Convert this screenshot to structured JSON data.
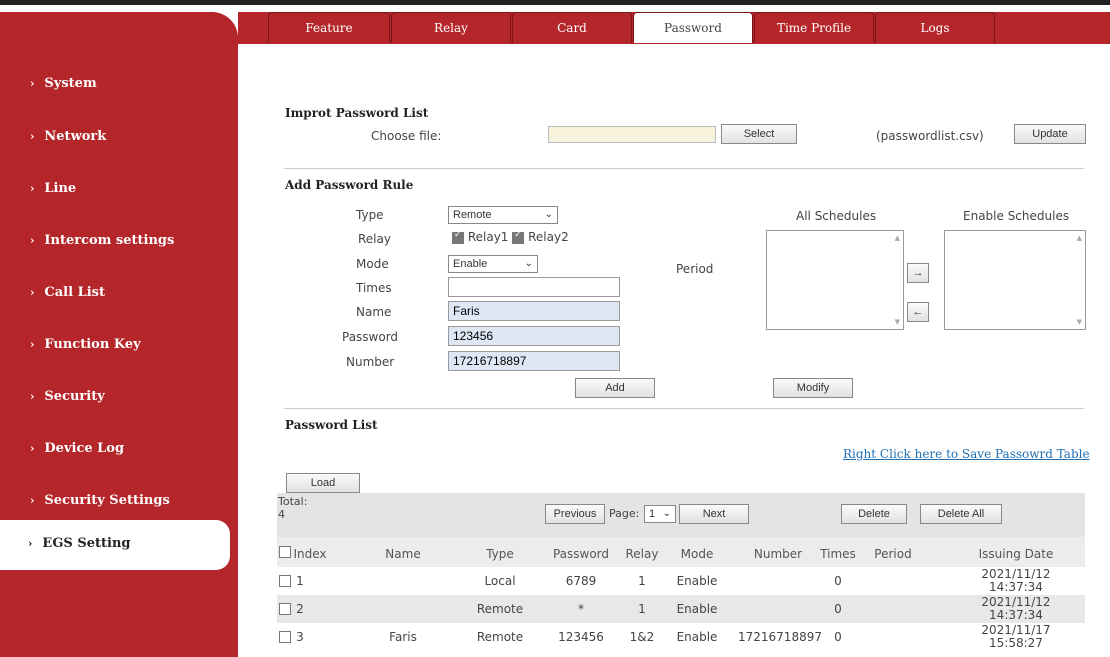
{
  "sidebar": {
    "items": [
      {
        "label": "System"
      },
      {
        "label": "Network"
      },
      {
        "label": "Line"
      },
      {
        "label": "Intercom settings"
      },
      {
        "label": "Call List"
      },
      {
        "label": "Function Key"
      },
      {
        "label": "Security"
      },
      {
        "label": "Device Log"
      },
      {
        "label": "Security Settings"
      },
      {
        "label": "EGS Setting"
      }
    ],
    "active": "EGS Setting"
  },
  "tabs": [
    {
      "label": "Feature"
    },
    {
      "label": "Relay"
    },
    {
      "label": "Card"
    },
    {
      "label": "Password"
    },
    {
      "label": "Time Profile"
    },
    {
      "label": "Logs"
    }
  ],
  "active_tab": "Password",
  "import": {
    "title": "Improt Password List",
    "choose_label": "Choose file:",
    "file_value": "",
    "select_btn": "Select",
    "hint": "(passwordlist.csv)",
    "update_btn": "Update"
  },
  "rule": {
    "title": "Add Password Rule",
    "type_label": "Type",
    "type_value": "Remote",
    "relay_label": "Relay",
    "relay1": "Relay1",
    "relay2": "Relay2",
    "mode_label": "Mode",
    "mode_value": "Enable",
    "times_label": "Times",
    "times_value": "",
    "name_label": "Name",
    "name_value": "Faris",
    "password_label": "Password",
    "password_value": "123456",
    "number_label": "Number",
    "number_value": "17216718897",
    "period_label": "Period",
    "all_schedules": "All Schedules",
    "enable_schedules": "Enable Schedules",
    "move_right": "→",
    "move_left": "←",
    "add_btn": "Add",
    "modify_btn": "Modify"
  },
  "list": {
    "title": "Password List",
    "save_link": "Right Click here to Save Passowrd Table",
    "load_btn": "Load",
    "total_label": "Total:",
    "total_value": "4",
    "prev_btn": "Previous",
    "page_label": "Page:",
    "page_value": "1",
    "next_btn": "Next",
    "delete_btn": "Delete",
    "delete_all_btn": "Delete All",
    "columns": [
      "Index",
      "Name",
      "Type",
      "Password",
      "Relay",
      "Mode",
      "Number",
      "Times",
      "Period",
      "Issuing Date"
    ],
    "rows": [
      {
        "index": "1",
        "name": "",
        "type": "Local",
        "password": "6789",
        "relay": "1",
        "mode": "Enable",
        "number": "",
        "times": "0",
        "period": "",
        "date": "2021/11/12",
        "time": "14:37:34"
      },
      {
        "index": "2",
        "name": "",
        "type": "Remote",
        "password": "*",
        "relay": "1",
        "mode": "Enable",
        "number": "",
        "times": "0",
        "period": "",
        "date": "2021/11/12",
        "time": "14:37:34"
      },
      {
        "index": "3",
        "name": "Faris",
        "type": "Remote",
        "password": "123456",
        "relay": "1&2",
        "mode": "Enable",
        "number": "17216718897",
        "times": "0",
        "period": "",
        "date": "2021/11/17",
        "time": "15:58:27"
      }
    ]
  },
  "colors": {
    "brand_red": "#b5262a",
    "row_alt": "#e8e8e8",
    "link": "#1f6fb5"
  }
}
